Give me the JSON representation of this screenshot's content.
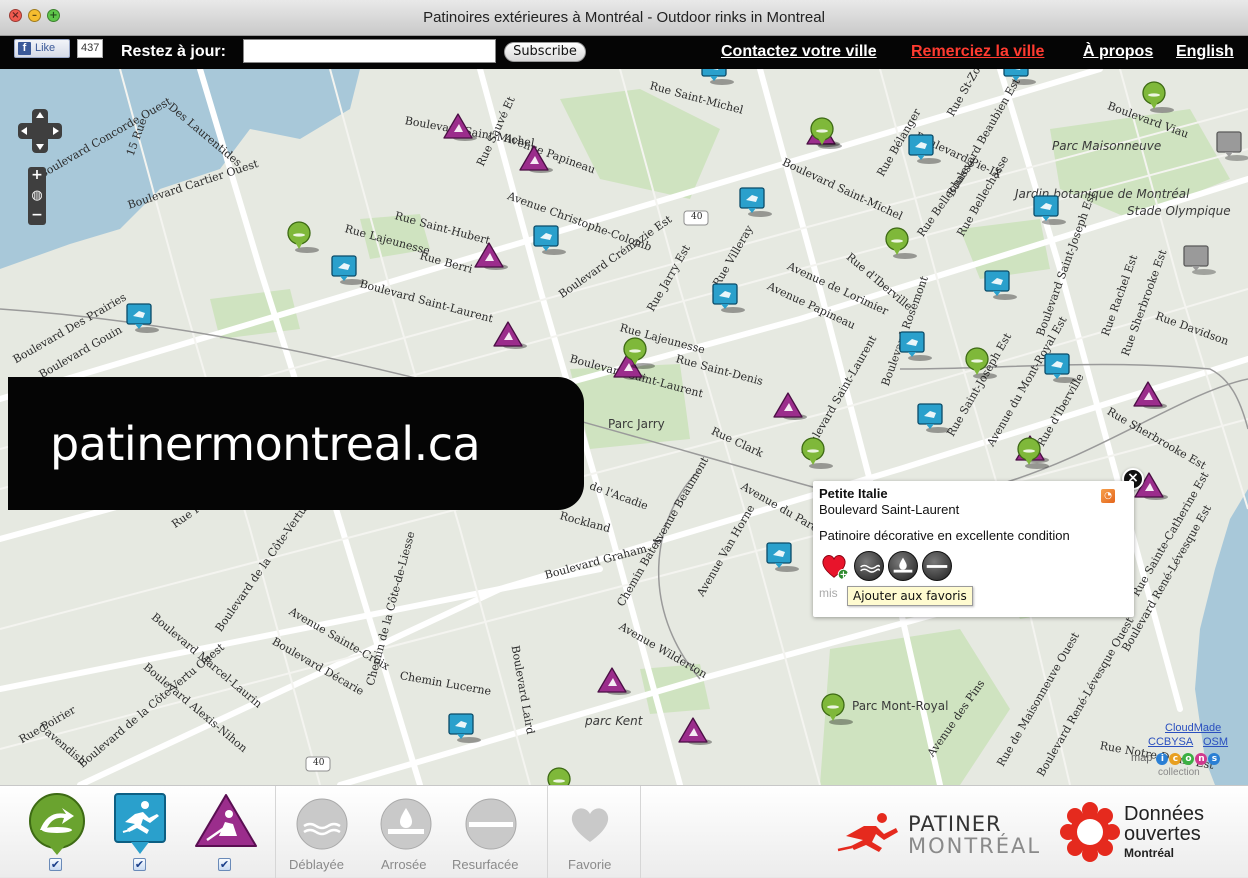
{
  "window": {
    "title": "Patinoires extérieures à Montréal - Outdoor rinks in Montreal",
    "controls": [
      "close-icon",
      "minimize-icon",
      "zoom-icon"
    ]
  },
  "topbar": {
    "fb_like_label": "Like",
    "fb_like_count": "437",
    "subscribe_prompt": "Restez à jour:",
    "email_value": "",
    "subscribe_label": "Subscribe",
    "nav": {
      "contact": "Contactez votre ville",
      "thanks": "Remerciez la ville",
      "about": "À propos",
      "language": "English"
    },
    "colors": {
      "background": "#050505",
      "thanks_link": "#ff3b30"
    }
  },
  "map": {
    "banner_text": "patinermontreal.ca",
    "street_labels": [
      "Boulevard Concorde Ouest",
      "15 Rue",
      "Boulevard Cartier Ouest",
      "Des Laurentides",
      "Rue Sauvé Et",
      "Avenue Papineau",
      "Boulevard Saint-Michel",
      "Rue Saint-Michel",
      "Boulevard Pie-IX",
      "Rue St-Zotique",
      "Boulevard Viau",
      "Parc Maisonneuve",
      "Jardin botanique de Montréal",
      "Stade Olympique",
      "Avenue Christophe-Colomb",
      "Rue Saint-Hubert",
      "Rue Lajeunesse",
      "Rue Berri",
      "Boulevard Saint-Laurent",
      "Boulevard Crémazie Est",
      "Rue Jarry Est",
      "Rue Villeray",
      "Avenue de Lorimier",
      "Avenue Papineau",
      "Rue d'Iberville",
      "Rue Bellechasse",
      "Boulevard Rosemont",
      "Boulevard Saint-Joseph Est",
      "Rue Rachel Est",
      "Rue Sherbrooke Est",
      "Rue Davidson",
      "Boulevard Des Prairies",
      "Boulevard Gouin",
      "Rue Lajeunesse",
      "Rue Saint-Denis",
      "Parc Jarry",
      "Rue Clark",
      "Boulevard Saint-Laurent",
      "de l'Acadie",
      "Rockland",
      "Avenue Beaumont",
      "Avenue du Parc",
      "Boulevard Graham",
      "Chemin Bates",
      "Avenue Van Horne",
      "Avenue Wilderton",
      "Rue Poirier",
      "Boulevard de la Côte-Vertu Ouest",
      "Avenue Sainte-Croix",
      "Boulevard Décarie",
      "Chemin de la Côte-de-Liesse",
      "Chemin Lucerne",
      "Boulevard Laird",
      "Boulevard Marcel-Laurin",
      "Boulevard Alexis-Nihon",
      "Rue Poirier",
      "Cavendish",
      "Boulevard de la Côte-Vertu Ouest",
      "parc Kent",
      "Parc Mont-Royal",
      "Avenue des Pins",
      "Rue de Maisonneuve Ouest",
      "Boulevard René-Lévesque Ouest",
      "Rue Sainte-Catherine Est",
      "Boulevard René-Lévesque Est",
      "Rue Sherbrooke Est",
      "Rue Notre-Dame Est",
      "Boulevard Saint-Michel",
      "Rue Bélanger",
      "Boulevard Beaubien Est",
      "Rue Bellechasse",
      "Rue Saint-Joseph Est",
      "Avenue du Mont-Royal Est",
      "Rue d'Iberville",
      "Boulevard Saint-Laurent"
    ],
    "highway_shields": [
      "40",
      "40"
    ],
    "popup": {
      "title": "Petite Italie",
      "subtitle": "Boulevard Saint-Laurent",
      "description": "Patinoire décorative en excellente condition",
      "tooltip": "Ajouter aux favoris",
      "faded_text": "mis",
      "icons": [
        "heart-add-icon",
        "cleared-icon",
        "watered-icon",
        "resurfaced-icon"
      ]
    },
    "attribution": {
      "cloudmade": "CloudMade",
      "license": "CCBYSA",
      "osm": "OSM",
      "mapicons": "map",
      "mapicons_letters": "icons",
      "collection": "collection"
    },
    "colors": {
      "map_background": "#e6e9e1",
      "park": "#cfe3c0",
      "water": "#a8c8d9",
      "marker_triangle": "#9b2d8c",
      "marker_square": "#2aa0cc",
      "marker_pin": "#7fb83a"
    }
  },
  "toolbar": {
    "filters": [
      {
        "name": "Patin libre",
        "icon": "pleasure-skating-icon",
        "checked": true
      },
      {
        "name": "Patin vitesse",
        "icon": "skater-icon",
        "checked": true
      },
      {
        "name": "Hockey",
        "icon": "hockey-icon",
        "checked": true
      }
    ],
    "conditions": [
      {
        "label": "Déblayée",
        "icon": "cleared-icon"
      },
      {
        "label": "Arrosée",
        "icon": "watered-icon"
      },
      {
        "label": "Resurfacée",
        "icon": "resurfaced-icon"
      }
    ],
    "favorite_label": "Favorie",
    "logo_patiner": [
      "PATINER",
      "MONTRÉAL"
    ],
    "logo_donnees": [
      "Données",
      "ouvertes",
      "Montréal"
    ],
    "check_mark": "✔"
  }
}
